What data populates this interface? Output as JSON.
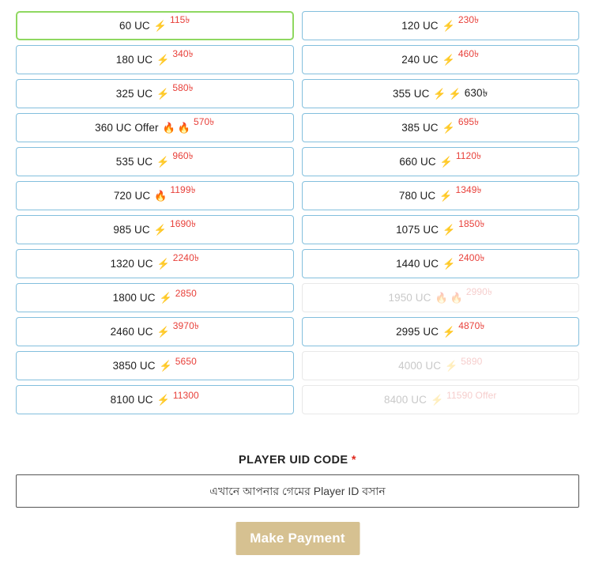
{
  "packages": [
    {
      "label": "60 UC",
      "icons": [
        "zap"
      ],
      "price": "115৳",
      "style": "sup",
      "state": "selected"
    },
    {
      "label": "120 UC",
      "icons": [
        "zap"
      ],
      "price": "230৳",
      "style": "sup",
      "state": "normal"
    },
    {
      "label": "180 UC",
      "icons": [
        "zap"
      ],
      "price": "340৳",
      "style": "sup",
      "state": "normal"
    },
    {
      "label": "240 UC",
      "icons": [
        "zap"
      ],
      "price": "460৳",
      "style": "sup",
      "state": "normal"
    },
    {
      "label": "325 UC",
      "icons": [
        "zap"
      ],
      "price": "580৳",
      "style": "sup",
      "state": "normal"
    },
    {
      "label": "355 UC",
      "icons": [
        "zap",
        "zap"
      ],
      "price": "630৳",
      "style": "plain",
      "state": "normal"
    },
    {
      "label": "360 UC Offer",
      "icons": [
        "fire",
        "fire"
      ],
      "price": "570৳",
      "style": "sup",
      "state": "normal"
    },
    {
      "label": "385 UC",
      "icons": [
        "zap"
      ],
      "price": "695৳",
      "style": "sup",
      "state": "normal"
    },
    {
      "label": "535 UC",
      "icons": [
        "zap"
      ],
      "price": "960৳",
      "style": "sup",
      "state": "normal"
    },
    {
      "label": "660 UC",
      "icons": [
        "zap"
      ],
      "price": "1120৳",
      "style": "sup",
      "state": "normal"
    },
    {
      "label": "720 UC",
      "icons": [
        "fire"
      ],
      "price": "1199৳",
      "style": "sup",
      "state": "normal"
    },
    {
      "label": "780 UC",
      "icons": [
        "zap"
      ],
      "price": "1349৳",
      "style": "sup",
      "state": "normal"
    },
    {
      "label": "985 UC",
      "icons": [
        "zap"
      ],
      "price": "1690৳",
      "style": "sup",
      "state": "normal"
    },
    {
      "label": "1075 UC",
      "icons": [
        "zap"
      ],
      "price": "1850৳",
      "style": "sup",
      "state": "normal"
    },
    {
      "label": "1320 UC",
      "icons": [
        "zap"
      ],
      "price": "2240৳",
      "style": "sup",
      "state": "normal"
    },
    {
      "label": "1440 UC",
      "icons": [
        "zap"
      ],
      "price": "2400৳",
      "style": "sup",
      "state": "normal"
    },
    {
      "label": "1800 UC",
      "icons": [
        "zap"
      ],
      "price": "2850",
      "style": "sup",
      "state": "normal"
    },
    {
      "label": "1950 UC",
      "icons": [
        "fire",
        "fire"
      ],
      "price": "2990৳",
      "style": "sup",
      "state": "disabled"
    },
    {
      "label": "2460 UC",
      "icons": [
        "zap"
      ],
      "price": "3970৳",
      "style": "sup",
      "state": "normal"
    },
    {
      "label": "2995 UC",
      "icons": [
        "zap"
      ],
      "price": "4870৳",
      "style": "sup",
      "state": "normal"
    },
    {
      "label": "3850 UC",
      "icons": [
        "zap"
      ],
      "price": "5650",
      "style": "sup",
      "state": "normal"
    },
    {
      "label": "4000 UC",
      "icons": [
        "zap"
      ],
      "price": "5890",
      "style": "sup",
      "state": "disabled"
    },
    {
      "label": "8100 UC",
      "icons": [
        "zap"
      ],
      "price": "11300",
      "style": "sup",
      "state": "normal"
    },
    {
      "label": "8400 UC",
      "icons": [
        "zap"
      ],
      "price": "11590 Offer",
      "style": "sup",
      "state": "disabled"
    }
  ],
  "form": {
    "uid_label": "PLAYER UID CODE",
    "required_marker": "*",
    "uid_placeholder": "এখানে আপনার গেমের Player ID বসান",
    "uid_value": "",
    "submit_label": "Make Payment"
  },
  "icons": {
    "zap": "⚡",
    "fire": "🔥"
  },
  "colors": {
    "selected_border": "#8fd860",
    "normal_border": "#83bfdd",
    "disabled_border": "#e8e8e8",
    "price_red": "#e8403a",
    "button_bg": "#d6c191",
    "required_red": "#e02b20"
  }
}
